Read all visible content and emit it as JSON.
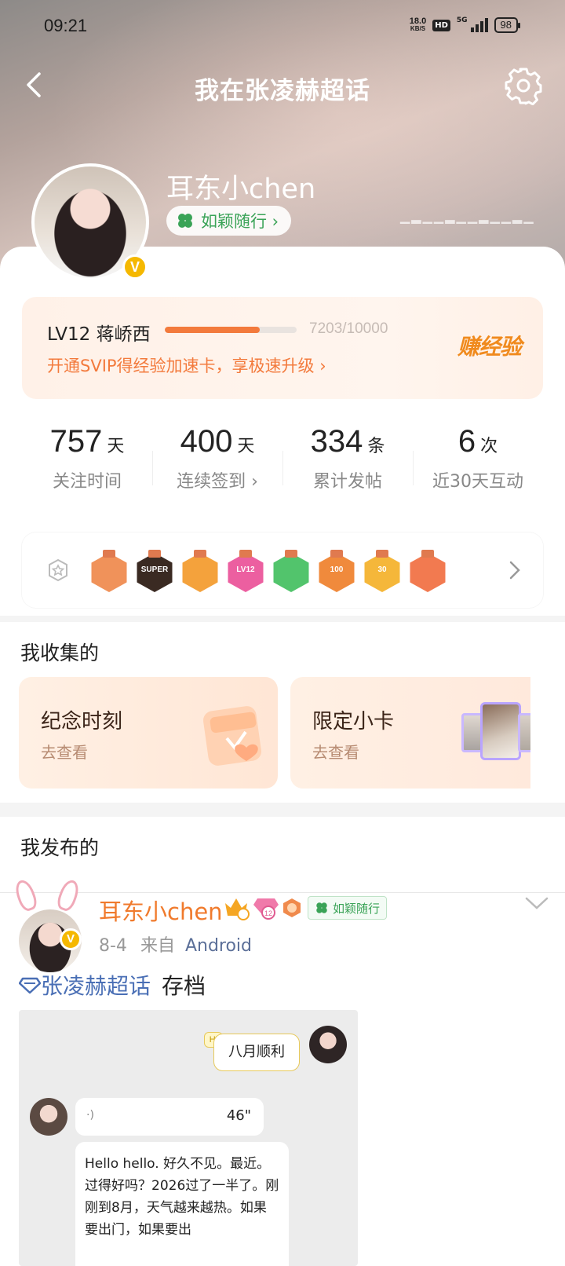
{
  "status_bar": {
    "time": "09:21",
    "net_speed": "18.0",
    "net_unit": "KB/S",
    "hd": "HD",
    "network": "5G",
    "battery": "98"
  },
  "header": {
    "title": "我在张凌赫超话"
  },
  "profile": {
    "username": "耳东小chen",
    "group_tag": "如颖随行 ›",
    "verified_badge": "V"
  },
  "level": {
    "label": "LV12 蒋峤西",
    "progress_text": "7203/10000",
    "progress": 0.7203,
    "promo": "开通SVIP得经验加速卡，享极速升级 ›",
    "earn": "赚经验"
  },
  "stats": [
    {
      "value": "757",
      "unit": "天",
      "label": "关注时间"
    },
    {
      "value": "400",
      "unit": "天",
      "label": "连续签到 ›"
    },
    {
      "value": "334",
      "unit": "条",
      "label": "累计发帖"
    },
    {
      "value": "6",
      "unit": "次",
      "label": "近30天互动"
    }
  ],
  "badges": [
    {
      "name": "rabbit-badge",
      "label": "",
      "color": "#f0925a"
    },
    {
      "name": "super-badge",
      "label": "SUPER",
      "color": "#3a2a22"
    },
    {
      "name": "crown-badge",
      "label": "",
      "color": "#f4a23c"
    },
    {
      "name": "lv12-badge",
      "label": "LV12",
      "color": "#ec5fa0"
    },
    {
      "name": "hand-badge",
      "label": "",
      "color": "#52c46c"
    },
    {
      "name": "100-days-badge",
      "label": "100",
      "color": "#f08a3c"
    },
    {
      "name": "30-days-badge",
      "label": "30",
      "color": "#f5b73a"
    },
    {
      "name": "heart-hand-badge",
      "label": "",
      "color": "#f27a50"
    }
  ],
  "collect": {
    "title": "我收集的",
    "cards": [
      {
        "title": "纪念时刻",
        "action": "去查看"
      },
      {
        "title": "限定小卡",
        "action": "去查看"
      }
    ]
  },
  "posts_section": {
    "title": "我发布的"
  },
  "post": {
    "author": "耳东小chen",
    "date": "8-4",
    "source_prefix": "来自",
    "source": "Android",
    "group_tag": "如颖随行",
    "topic": "张凌赫超话",
    "text": "存档",
    "image": {
      "bubble_hi": "Hi",
      "bubble_text": "八月顺利",
      "voice_duration": "46\"",
      "message": "Hello hello. 好久不见。最近。过得好吗？2026过了一半了。刚刚到8月，天气越来越热。如果要出门，如果要出"
    }
  }
}
